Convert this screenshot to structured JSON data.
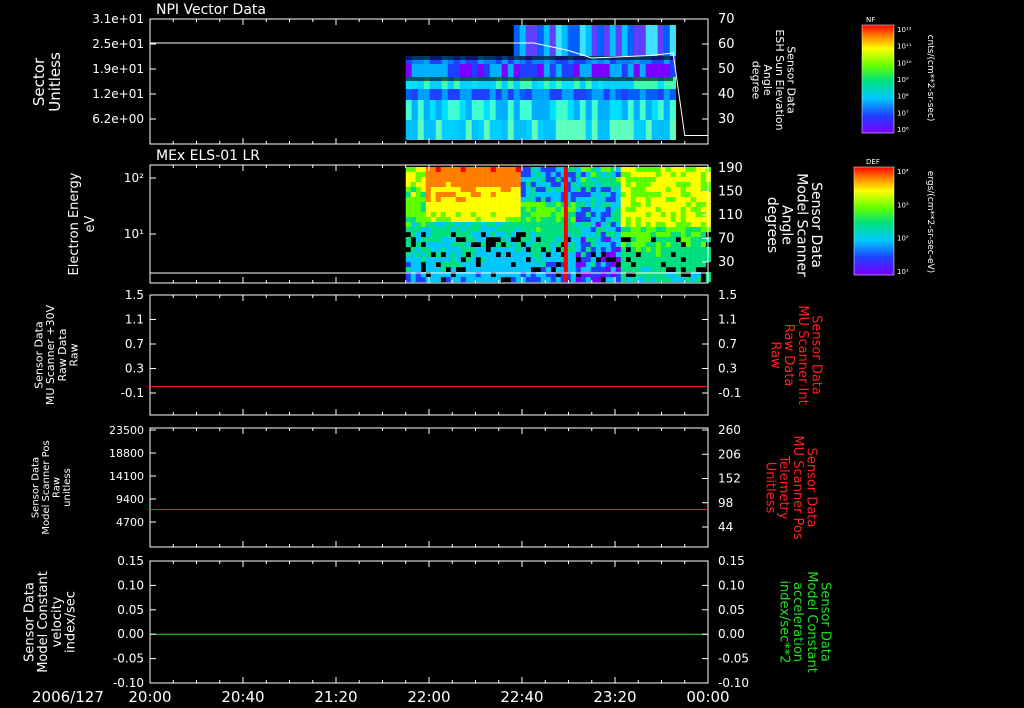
{
  "time_axis": {
    "labels": [
      "20:00",
      "20:40",
      "21:20",
      "22:00",
      "22:40",
      "23:20",
      "00:00"
    ],
    "date_label": "2006/127"
  },
  "colors": {
    "red_line": "#ff2020",
    "green_line": "#20e020",
    "white": "#ffffff",
    "right_label_red": "#ff2020",
    "right_label_green": "#20e020"
  },
  "chart_data": [
    {
      "type": "heatmap",
      "title": "NPI Vector Data",
      "ylabel": "Sector\nUnitless",
      "yticks": [
        "3.1e+01",
        "2.5e+01",
        "1.9e+01",
        "1.2e+01",
        "6.2e+00"
      ],
      "right_ylabel": [
        "Sensor Data",
        "ESH Sun Elevation",
        "Angle",
        "degree"
      ],
      "right_yticks": [
        70,
        60,
        50,
        40,
        30
      ],
      "colorbar": {
        "label": "NF",
        "units": "cnts/(cm**2-sr-sec)",
        "ticks": [
          "10¹²",
          "10¹¹",
          "10¹⁰",
          "10⁹",
          "10⁸",
          "10⁷",
          "10⁶"
        ]
      },
      "overlay_line": {
        "name": "ESH Sun Elevation",
        "x": [
          "20:00",
          "22:45",
          "23:00",
          "23:10",
          "23:35",
          "23:45",
          "23:50",
          "23:57",
          "00:00"
        ],
        "y": [
          62,
          62,
          59,
          56,
          57,
          58,
          25,
          25,
          25
        ]
      }
    },
    {
      "type": "heatmap",
      "title": "MEx ELS-01 LR",
      "ylabel": "Electron Energy\neV",
      "yticks": [
        "10²",
        "10¹"
      ],
      "right_ylabel": [
        "Sensor Data",
        "Model Scanner",
        "Angle",
        "degrees"
      ],
      "right_yticks": [
        190,
        150,
        110,
        70,
        30
      ],
      "colorbar": {
        "label": "DEF",
        "units": "ergs/(cm**2-sr-sec-eV)",
        "ticks": [
          "10⁴",
          "10³",
          "10²",
          "10¹"
        ]
      }
    },
    {
      "type": "line",
      "ylabel": [
        "Sensor Data",
        "MU Scanner +30V",
        "Raw Data",
        "Raw"
      ],
      "yticks": [
        "1.5",
        "1.1",
        "0.7",
        "0.3",
        "-0.1"
      ],
      "ylim": [
        -0.4,
        1.5
      ],
      "right_ylabel": [
        "Sensor Data",
        "MU Scanner Int",
        "Raw Data",
        "Raw"
      ],
      "right_yticks": [
        "1.5",
        "1.1",
        "0.7",
        "0.3",
        "-0.1"
      ],
      "series": [
        {
          "x": [
            "20:00",
            "00:00"
          ],
          "y": [
            0.05,
            0.05
          ]
        }
      ]
    },
    {
      "type": "line",
      "ylabel": [
        "Sensor Data",
        "Model Scanner Pos",
        "Raw",
        "unitless"
      ],
      "yticks": [
        "23500",
        "18800",
        "14100",
        "9400",
        "4700"
      ],
      "ylim": [
        0,
        23500
      ],
      "right_ylabel": [
        "Sensor Data",
        "MU Scanner Pos",
        "Telemetry",
        "Unitless"
      ],
      "right_yticks": [
        260,
        206,
        152,
        98,
        44
      ],
      "series": [
        {
          "x": [
            "20:00",
            "00:00"
          ],
          "y": [
            7400,
            7400
          ]
        }
      ]
    },
    {
      "type": "line",
      "ylabel": [
        "Sensor Data",
        "Model Constant",
        "velocity",
        "index/sec"
      ],
      "yticks": [
        "0.15",
        "0.10",
        "0.05",
        "0.00",
        "-0.05",
        "-0.10"
      ],
      "ylim": [
        -0.1,
        0.15
      ],
      "right_ylabel": [
        "Sensor Data",
        "Model Constant",
        "acceleration",
        "index/sec**2"
      ],
      "right_yticks": [
        "0.15",
        "0.10",
        "0.05",
        "0.00",
        "-0.05",
        "-0.10"
      ],
      "series": [
        {
          "x": [
            "20:00",
            "00:00"
          ],
          "y": [
            0.0,
            0.0
          ]
        }
      ]
    }
  ]
}
